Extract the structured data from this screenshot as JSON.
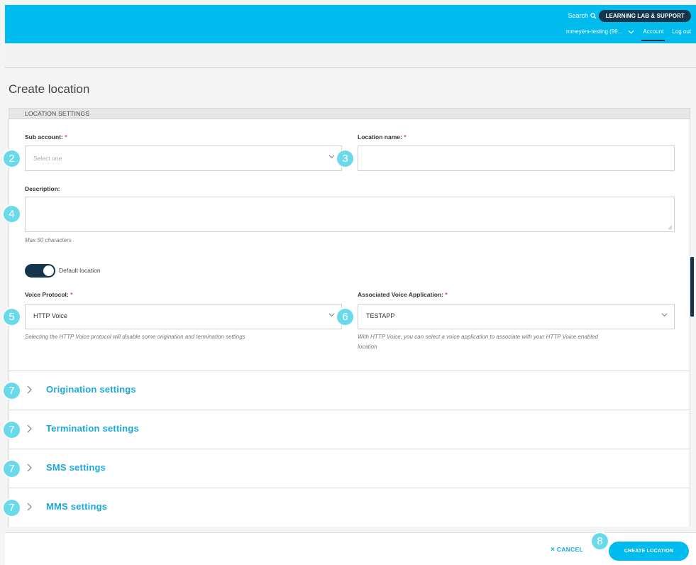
{
  "header": {
    "search_label": "Search",
    "learning_button": "LEARNING LAB & SUPPORT",
    "user_menu": "mmeyers-testing (99...",
    "account_link": "Account",
    "logout_link": "Log out"
  },
  "page": {
    "title": "Create location"
  },
  "card": {
    "section_title": "LOCATION SETTINGS"
  },
  "form": {
    "sub_account": {
      "label": "Sub account:",
      "required": "*",
      "placeholder": "Select one"
    },
    "location_name": {
      "label": "Location name:",
      "required": "*",
      "value": ""
    },
    "description": {
      "label": "Description:",
      "value": "",
      "hint": "Max 50 characters"
    },
    "default_location": {
      "label": "Default location",
      "enabled": true
    },
    "voice_protocol": {
      "label": "Voice Protocol:",
      "required": "*",
      "value": "HTTP Voice",
      "hint": "Selecting the HTTP Voice protocol will disable some origination and termination settings"
    },
    "voice_application": {
      "label": "Associated Voice Application:",
      "required": "*",
      "value": "TESTAPP",
      "hint_line1": "With HTTP Voice, you can select a voice application to associate with your HTTP Voice enabled",
      "hint_line2": "location"
    }
  },
  "accordions": [
    {
      "title": "Origination settings"
    },
    {
      "title": "Termination settings"
    },
    {
      "title": "SMS settings"
    },
    {
      "title": "MMS settings"
    }
  ],
  "markers": [
    "2",
    "3",
    "4",
    "5",
    "6",
    "7",
    "7",
    "7",
    "7",
    "8"
  ],
  "footer": {
    "cancel_label": "CANCEL",
    "cancel_icon": "×",
    "create_label": "CREATE LOCATION"
  },
  "colors": {
    "brand": "#00bbee",
    "navy": "#15354d",
    "marker": "#6ad9ea",
    "link": "#1aa9d9"
  }
}
